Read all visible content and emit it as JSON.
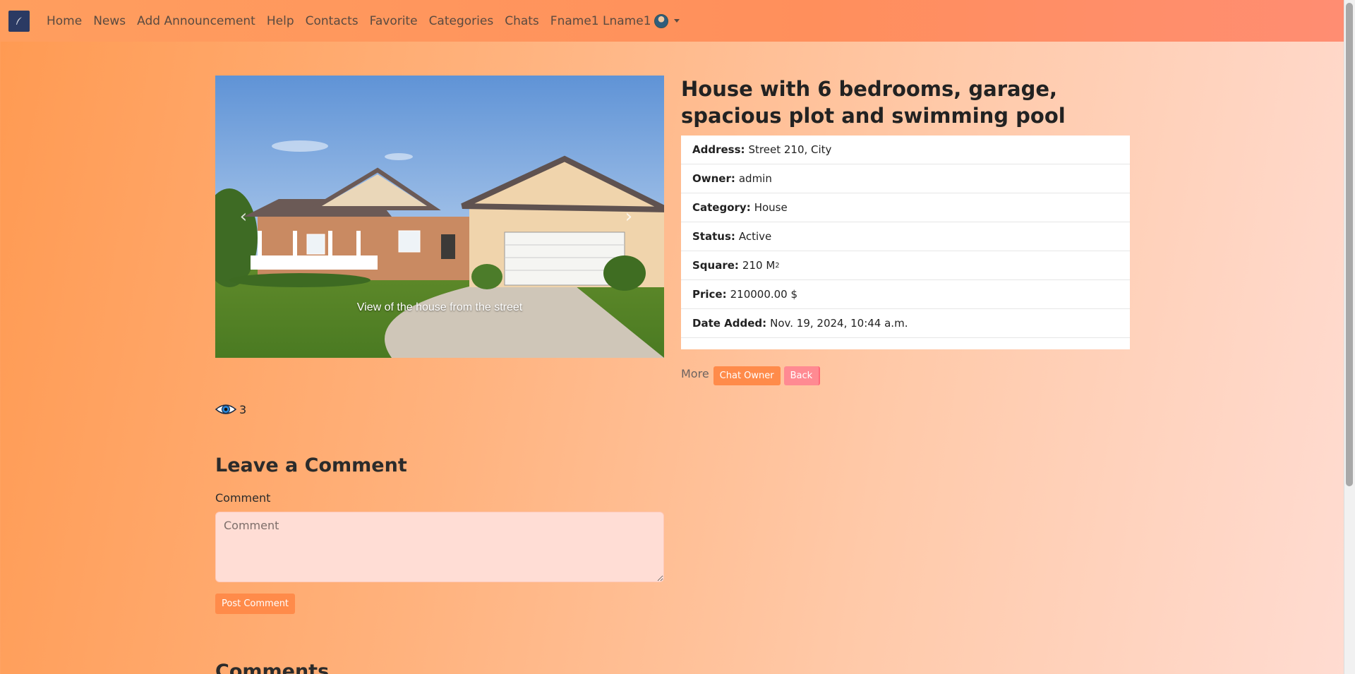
{
  "nav": {
    "brand_icon": "feather-logo-icon",
    "items": [
      "Home",
      "News",
      "Add Announcement",
      "Help",
      "Contacts",
      "Favorite",
      "Categories",
      "Chats"
    ],
    "user_name": "Fname1 Lname1"
  },
  "carousel": {
    "caption": "View of the house from the street",
    "prev_glyph": "‹",
    "next_glyph": "›"
  },
  "listing": {
    "title": "House with 6 bedrooms, garage, spacious plot and swimming pool",
    "details": [
      {
        "label": "Address:",
        "value": "Street 210, City"
      },
      {
        "label": "Owner:",
        "value": "admin"
      },
      {
        "label": "Category:",
        "value": "House"
      },
      {
        "label": "Status:",
        "value": "Active"
      },
      {
        "label": "Square:",
        "value": "210 M",
        "sup": "2"
      },
      {
        "label": "Price:",
        "value": "210000.00 $"
      },
      {
        "label": "Date Added:",
        "value": "Nov. 19, 2024, 10:44 a.m."
      }
    ],
    "more_label": "More",
    "chat_owner_label": "Chat Owner",
    "back_label": "Back"
  },
  "views": {
    "icon": "eye-icon",
    "count": "3"
  },
  "comment_form": {
    "heading": "Leave a Comment",
    "label": "Comment",
    "placeholder": "Comment",
    "submit_label": "Post Comment"
  },
  "comments": {
    "heading": "Comments"
  },
  "colors": {
    "accent": "#ff8b4a",
    "back_button": "#ff8a92",
    "brand_bg": "#2b3a63"
  }
}
